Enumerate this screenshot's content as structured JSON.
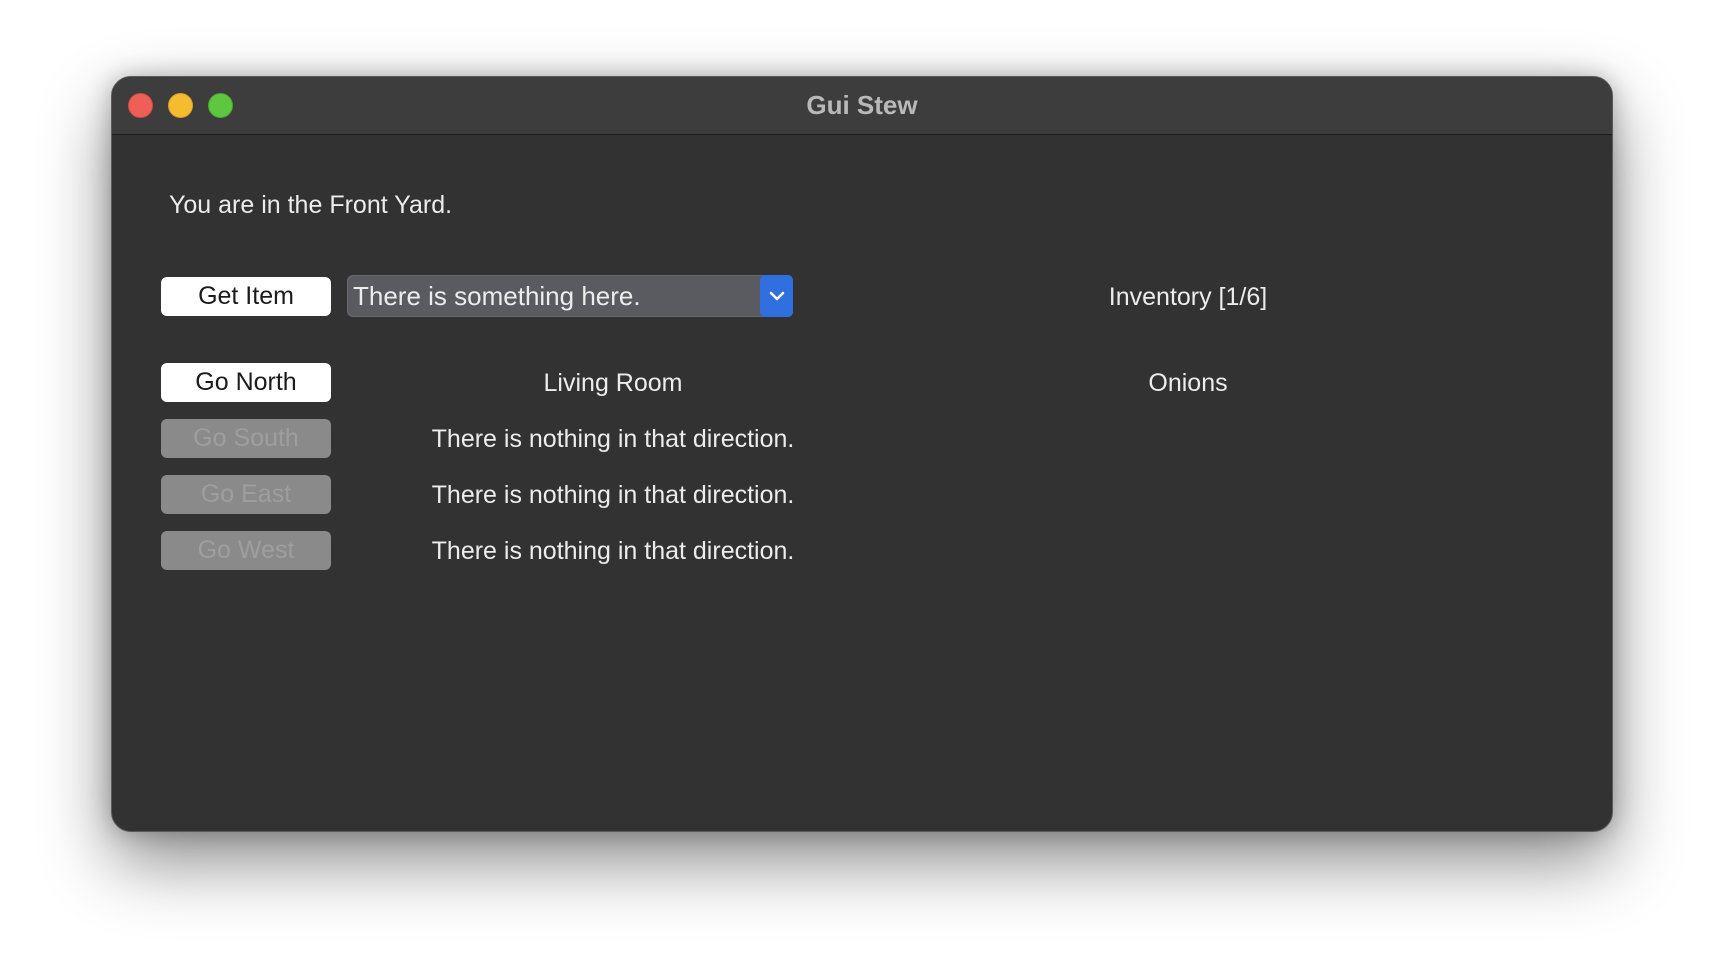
{
  "window": {
    "title": "Gui Stew"
  },
  "location_text": "You are in the Front Yard.",
  "item": {
    "get_label": "Get Item",
    "select_value": "There is something here."
  },
  "inventory": {
    "header": "Inventory [1/6]",
    "items": [
      "Onions"
    ]
  },
  "directions": [
    {
      "label": "Go North",
      "enabled": true,
      "destination": "Living Room"
    },
    {
      "label": "Go South",
      "enabled": false,
      "destination": "There is nothing in that direction."
    },
    {
      "label": "Go East",
      "enabled": false,
      "destination": "There is nothing in that direction."
    },
    {
      "label": "Go West",
      "enabled": false,
      "destination": "There is nothing in that direction."
    }
  ],
  "colors": {
    "window_bg": "#323232",
    "titlebar_bg": "#3d3d3d",
    "dropdown_accent": "#2f6fe0",
    "close": "#ee5f57",
    "minimize": "#f5bc2f",
    "zoom": "#5fc63f"
  },
  "icons": {
    "dropdown": "chevron-down-icon"
  }
}
